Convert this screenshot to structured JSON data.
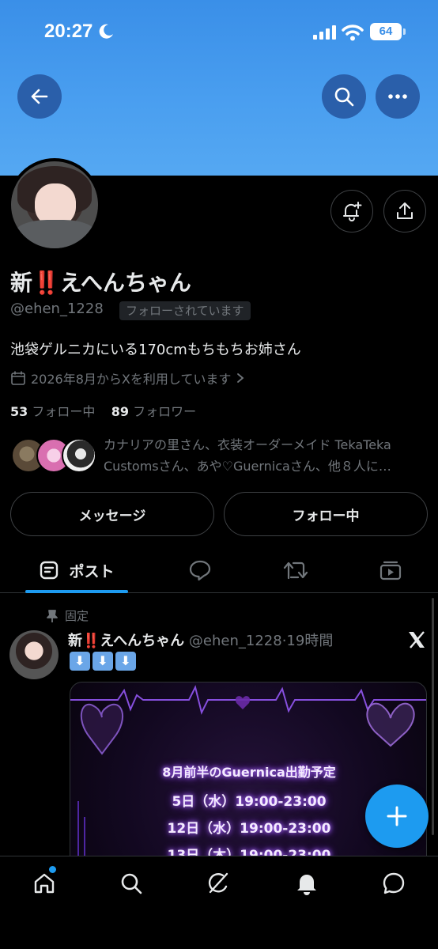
{
  "status_bar": {
    "time": "20:27",
    "battery": "64"
  },
  "profile": {
    "name_prefix": "新",
    "name_marks": "‼️",
    "name_suffix": "えへんちゃん",
    "handle": "@ehen_1228",
    "follows_you_badge": "フォローされています",
    "bio": "池袋ゲルニカにいる170cmもちもちお姉さん",
    "joined": "2026年8月からXを利用しています",
    "following_count": "53",
    "following_label": "フォロー中",
    "followers_count": "89",
    "followers_label": "フォロワー",
    "followers_you_know": "カナリアの里さん、衣装オーダーメイド TekaTeka Customsさん、あや♡Guernicaさん、他８人に…"
  },
  "buttons": {
    "message": "メッセージ",
    "following": "フォロー中"
  },
  "tabs": [
    {
      "label": "ポスト"
    }
  ],
  "post": {
    "pinned_label": "固定",
    "author_prefix": "新",
    "author_marks": "‼️",
    "author_suffix": "えへんちゃん",
    "handle": "@ehen_1228",
    "time": "19時間",
    "arrows": [
      "⬇",
      "⬇",
      "⬇"
    ],
    "media": {
      "title": "8月前半のGuernica出勤予定",
      "lines": [
        "5日（水）19:00-23:00",
        "12日（水）19:00-23:00",
        "13日（木）19:00-23:00"
      ]
    }
  },
  "colors": {
    "accent": "#1d9bf0",
    "banner": "#4a9ff0",
    "mark_red": "#e0245e"
  }
}
